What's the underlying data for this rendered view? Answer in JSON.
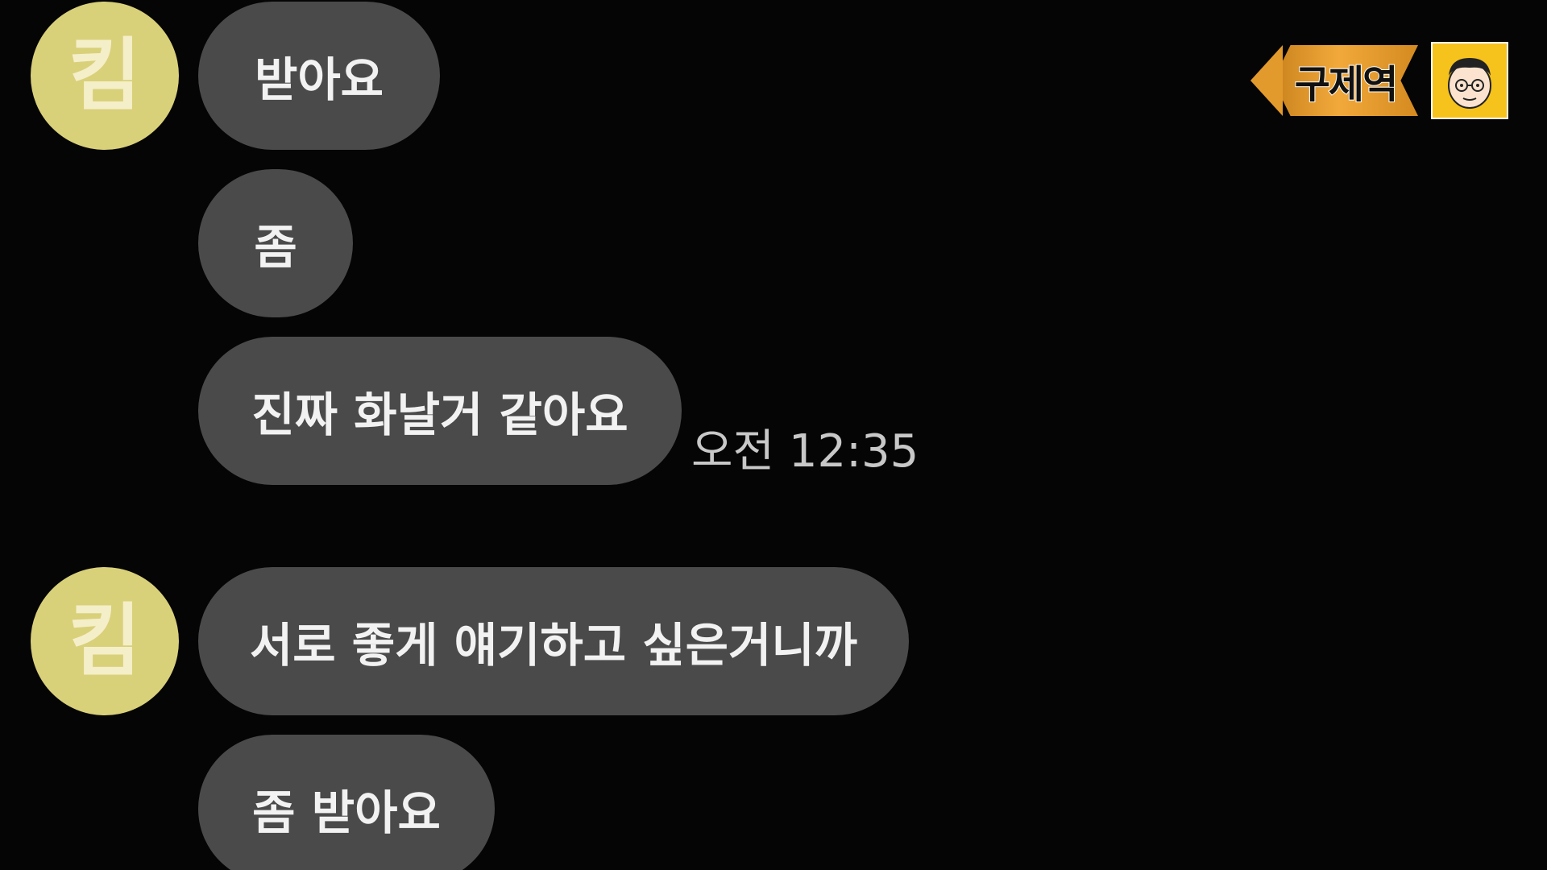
{
  "avatar_label": "킴",
  "messages": [
    {
      "text": "받아요"
    },
    {
      "text": "좀"
    },
    {
      "text": "진짜 화날거 같아요"
    },
    {
      "text": "서로 좋게 얘기하고 싶은거니까"
    },
    {
      "text": "좀 받아요"
    }
  ],
  "timestamp": "오전 12:35",
  "brand": {
    "text": "구제역",
    "icon": "cartoon-face-icon"
  },
  "colors": {
    "background": "#050505",
    "bubble": "#4a4a4a",
    "avatar": "#d9d07a",
    "brand_orange": "#f2a93b",
    "brand_yellow": "#f6c21c"
  }
}
